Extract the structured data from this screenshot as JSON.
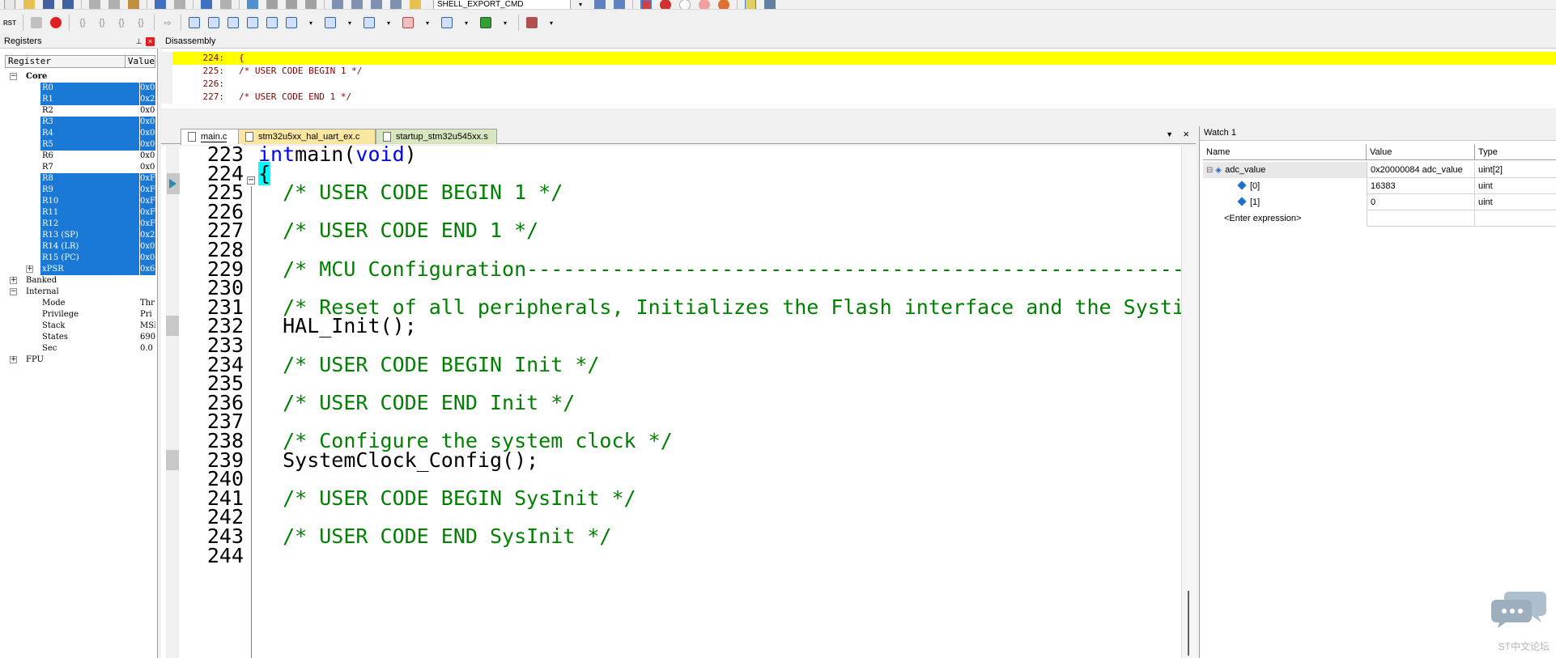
{
  "toolbar": {
    "combo_value": "SHELL_EXPORT_CMD",
    "rst_label": "RST"
  },
  "registers": {
    "title": "Registers",
    "col_register": "Register",
    "col_value": "Value",
    "rows": [
      {
        "type": "group",
        "name": "Core",
        "expanded": true,
        "bold": true
      },
      {
        "type": "reg",
        "name": "R0",
        "val": "0x0",
        "sel": true
      },
      {
        "type": "reg",
        "name": "R1",
        "val": "0x2",
        "sel": true
      },
      {
        "type": "reg",
        "name": "R2",
        "val": "0x0",
        "sel": false
      },
      {
        "type": "reg",
        "name": "R3",
        "val": "0x0",
        "sel": true
      },
      {
        "type": "reg",
        "name": "R4",
        "val": "0x0",
        "sel": true
      },
      {
        "type": "reg",
        "name": "R5",
        "val": "0x0",
        "sel": true
      },
      {
        "type": "reg",
        "name": "R6",
        "val": "0x0",
        "sel": false
      },
      {
        "type": "reg",
        "name": "R7",
        "val": "0x0",
        "sel": false
      },
      {
        "type": "reg",
        "name": "R8",
        "val": "0xF",
        "sel": true
      },
      {
        "type": "reg",
        "name": "R9",
        "val": "0xF",
        "sel": true
      },
      {
        "type": "reg",
        "name": "R10",
        "val": "0xF",
        "sel": true
      },
      {
        "type": "reg",
        "name": "R11",
        "val": "0xF",
        "sel": true
      },
      {
        "type": "reg",
        "name": "R12",
        "val": "0xF",
        "sel": true
      },
      {
        "type": "reg",
        "name": "R13 (SP)",
        "val": "0x2",
        "sel": true
      },
      {
        "type": "reg",
        "name": "R14 (LR)",
        "val": "0x0",
        "sel": true
      },
      {
        "type": "reg",
        "name": "R15 (PC)",
        "val": "0x0",
        "sel": true
      },
      {
        "type": "reg",
        "name": "xPSR",
        "val": "0x6",
        "sel": true,
        "expander": "+"
      },
      {
        "type": "group",
        "name": "Banked",
        "expanded": false,
        "bold": false
      },
      {
        "type": "group",
        "name": "Internal",
        "expanded": true,
        "bold": false
      },
      {
        "type": "reg",
        "name": "Mode",
        "val": "Thr",
        "sel": false
      },
      {
        "type": "reg",
        "name": "Privilege",
        "val": "Pri",
        "sel": false
      },
      {
        "type": "reg",
        "name": "Stack",
        "val": "MSP",
        "sel": false
      },
      {
        "type": "reg",
        "name": "States",
        "val": "690",
        "sel": false
      },
      {
        "type": "reg",
        "name": "Sec",
        "val": "0.0",
        "sel": false
      },
      {
        "type": "group",
        "name": "FPU",
        "expanded": false,
        "bold": false
      }
    ]
  },
  "disassembly": {
    "title": "Disassembly",
    "lines": [
      {
        "no": "224:",
        "text": "{",
        "current": true
      },
      {
        "no": "225:",
        "text": "/* USER CODE BEGIN 1 */",
        "current": false
      },
      {
        "no": "226:",
        "text": "",
        "current": false
      },
      {
        "no": "227:",
        "text": "/* USER CODE END 1 */",
        "current": false
      }
    ]
  },
  "editor": {
    "tabs": [
      {
        "label": "main.c",
        "active": true
      },
      {
        "label": "stm32u5xx_hal_uart_ex.c",
        "active": false
      },
      {
        "label": "startup_stm32u545xx.s",
        "active": false
      }
    ],
    "lines": [
      {
        "no": "223",
        "parts": [
          [
            "kw",
            "int"
          ],
          [
            "",
            "main("
          ],
          [
            "kw",
            "void"
          ],
          [
            "",
            ")"
          ]
        ]
      },
      {
        "no": "224",
        "parts": [
          [
            "brace",
            "{"
          ]
        ]
      },
      {
        "no": "225",
        "parts": [
          [
            "cm",
            "  /* USER CODE BEGIN 1 */"
          ]
        ]
      },
      {
        "no": "226",
        "parts": []
      },
      {
        "no": "227",
        "parts": [
          [
            "cm",
            "  /* USER CODE END 1 */"
          ]
        ]
      },
      {
        "no": "228",
        "parts": []
      },
      {
        "no": "229",
        "parts": [
          [
            "cm",
            "  /* MCU Configuration--------------------------------------------------------"
          ]
        ]
      },
      {
        "no": "230",
        "parts": []
      },
      {
        "no": "231",
        "parts": [
          [
            "cm",
            "  /* Reset of all peripherals, Initializes the Flash interface and the Systick. */"
          ]
        ]
      },
      {
        "no": "232",
        "parts": [
          [
            "",
            "  HAL_Init();"
          ]
        ],
        "bp": true
      },
      {
        "no": "233",
        "parts": []
      },
      {
        "no": "234",
        "parts": [
          [
            "cm",
            "  /* USER CODE BEGIN Init */"
          ]
        ]
      },
      {
        "no": "235",
        "parts": []
      },
      {
        "no": "236",
        "parts": [
          [
            "cm",
            "  /* USER CODE END Init */"
          ]
        ]
      },
      {
        "no": "237",
        "parts": []
      },
      {
        "no": "238",
        "parts": [
          [
            "cm",
            "  /* Configure the system clock */"
          ]
        ]
      },
      {
        "no": "239",
        "parts": [
          [
            "",
            "  SystemClock_Config();"
          ]
        ],
        "bp": true
      },
      {
        "no": "240",
        "parts": []
      },
      {
        "no": "241",
        "parts": [
          [
            "cm",
            "  /* USER CODE BEGIN SysInit */"
          ]
        ]
      },
      {
        "no": "242",
        "parts": []
      },
      {
        "no": "243",
        "parts": [
          [
            "cm",
            "  /* USER CODE END SysInit */"
          ]
        ]
      },
      {
        "no": "244",
        "parts": []
      }
    ]
  },
  "watch": {
    "title": "Watch 1",
    "col_name": "Name",
    "col_value": "Value",
    "col_type": "Type",
    "rows": [
      {
        "name": "adc_value",
        "value": "0x20000084 adc_value",
        "type": "uint[2]",
        "level": 0,
        "selected": true
      },
      {
        "name": "[0]",
        "value": "16383",
        "type": "uint",
        "level": 1
      },
      {
        "name": "[1]",
        "value": "0",
        "type": "uint",
        "level": 1
      },
      {
        "name": "<Enter expression>",
        "value": "",
        "type": "",
        "level": 0
      }
    ]
  },
  "watermark": {
    "text": "ST中文论坛"
  }
}
